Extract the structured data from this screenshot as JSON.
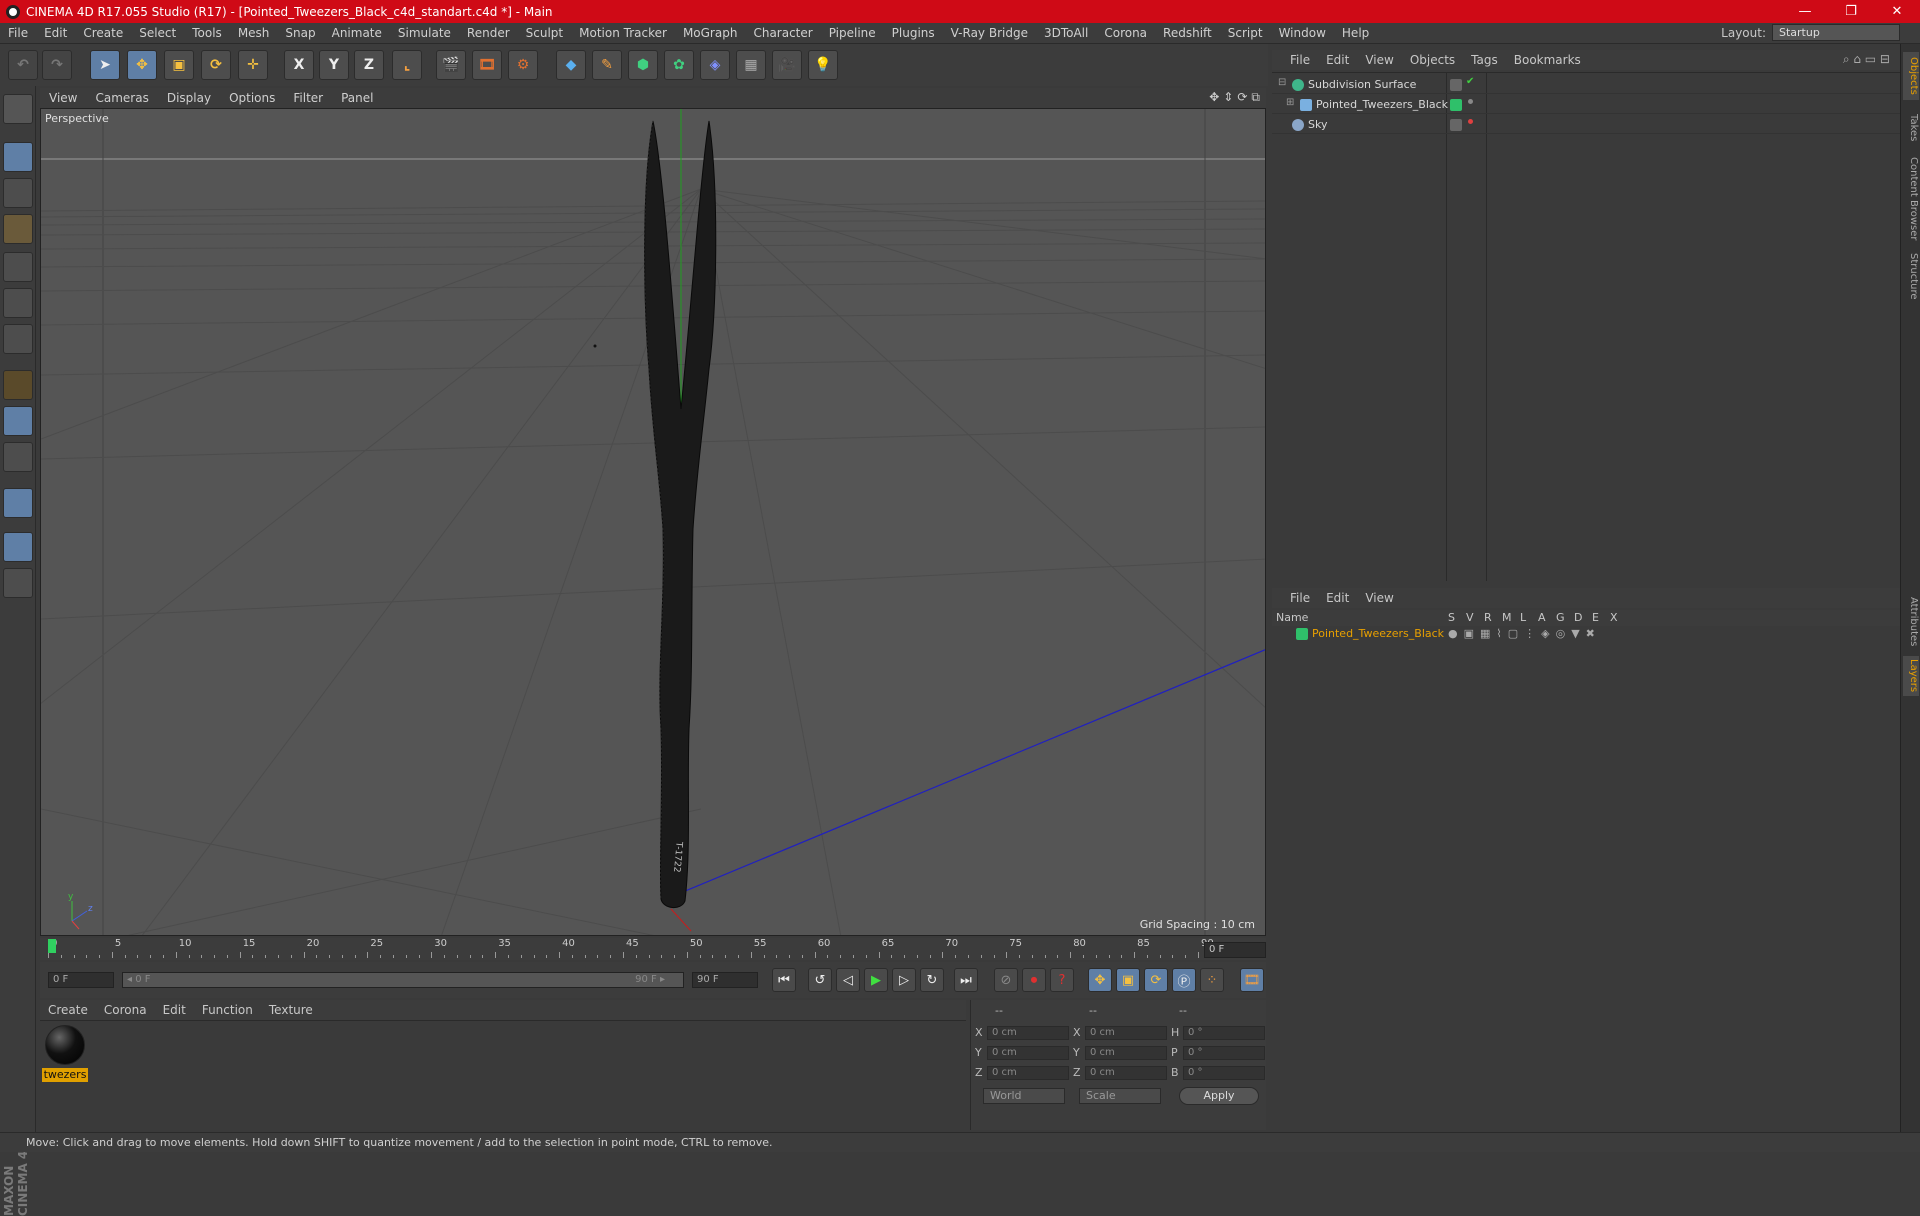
{
  "window": {
    "title": "CINEMA 4D R17.055 Studio (R17) - [Pointed_Tweezers_Black_c4d_standart.c4d *] - Main",
    "controls": [
      "—",
      "❐",
      "✕"
    ]
  },
  "menubar": {
    "items": [
      "File",
      "Edit",
      "Create",
      "Select",
      "Tools",
      "Mesh",
      "Snap",
      "Animate",
      "Simulate",
      "Render",
      "Sculpt",
      "Motion Tracker",
      "MoGraph",
      "Character",
      "Pipeline",
      "Plugins",
      "V-Ray Bridge",
      "3DToAll",
      "Corona",
      "Redshift",
      "Script",
      "Window",
      "Help"
    ],
    "layout_label": "Layout:",
    "layout_value": "Startup"
  },
  "toolbar": {
    "axis_x": "X",
    "axis_y": "Y",
    "axis_z": "Z"
  },
  "viewport": {
    "menu": [
      "View",
      "Cameras",
      "Display",
      "Options",
      "Filter",
      "Panel"
    ],
    "label": "Perspective",
    "grid_spacing": "Grid Spacing : 10 cm",
    "nav_icons": [
      "✥",
      "⇕",
      "⟳",
      "⧉"
    ],
    "axis_labels": {
      "x": "x",
      "y": "y",
      "z": "z"
    }
  },
  "timeline": {
    "ticks": [
      "0",
      "5",
      "10",
      "15",
      "20",
      "25",
      "30",
      "35",
      "40",
      "45",
      "50",
      "55",
      "60",
      "65",
      "70",
      "75",
      "80",
      "85",
      "90"
    ],
    "current_frame": "0 F"
  },
  "transport": {
    "start_field": "0 F",
    "slider_left": "◂ 0 F",
    "slider_right": "90 F ▸",
    "end_field": "90 F"
  },
  "material_manager": {
    "menu": [
      "Create",
      "Corona",
      "Edit",
      "Function",
      "Texture"
    ],
    "materials": [
      {
        "name": "twezers"
      }
    ]
  },
  "coordinates": {
    "headers": [
      "--",
      "--",
      "--"
    ],
    "rows": [
      {
        "l1": "X",
        "v1": "0 cm",
        "l2": "X",
        "v2": "0 cm",
        "l3": "H",
        "v3": "0 °"
      },
      {
        "l1": "Y",
        "v1": "0 cm",
        "l2": "Y",
        "v2": "0 cm",
        "l3": "P",
        "v3": "0 °"
      },
      {
        "l1": "Z",
        "v1": "0 cm",
        "l2": "Z",
        "v2": "0 cm",
        "l3": "B",
        "v3": "0 °"
      }
    ],
    "mode_world": "World",
    "mode_scale": "Scale",
    "apply": "Apply"
  },
  "object_manager": {
    "menu": [
      "File",
      "Edit",
      "View",
      "Objects",
      "Tags",
      "Bookmarks"
    ],
    "objects": [
      {
        "name": "Subdivision Surface",
        "color": "#3fb58a"
      },
      {
        "name": "Pointed_Tweezers_Black",
        "color": "#7ab0e0"
      },
      {
        "name": "Sky",
        "color": "#8aa6c8"
      }
    ]
  },
  "layer_manager": {
    "menu": [
      "File",
      "Edit",
      "View"
    ],
    "columns": [
      "Name",
      "S",
      "V",
      "R",
      "M",
      "L",
      "A",
      "G",
      "D",
      "E",
      "X"
    ],
    "layers": [
      {
        "name": "Pointed_Tweezers_Black",
        "color": "#2fc06a",
        "name_color": "#e8a000"
      }
    ]
  },
  "side_tabs": [
    "Objects",
    "Takes",
    "Content Browser",
    "Structure",
    "Attributes",
    "Layers"
  ],
  "statusbar": {
    "text": "Move: Click and drag to move elements. Hold down SHIFT to quantize movement / add to the selection in point mode, CTRL to remove."
  },
  "brand": "MAXON CINEMA 4D",
  "colors": {
    "title_red": "#cf0a16",
    "accent_blue": "#5f7fa6",
    "highlight_orange": "#e8a000"
  }
}
